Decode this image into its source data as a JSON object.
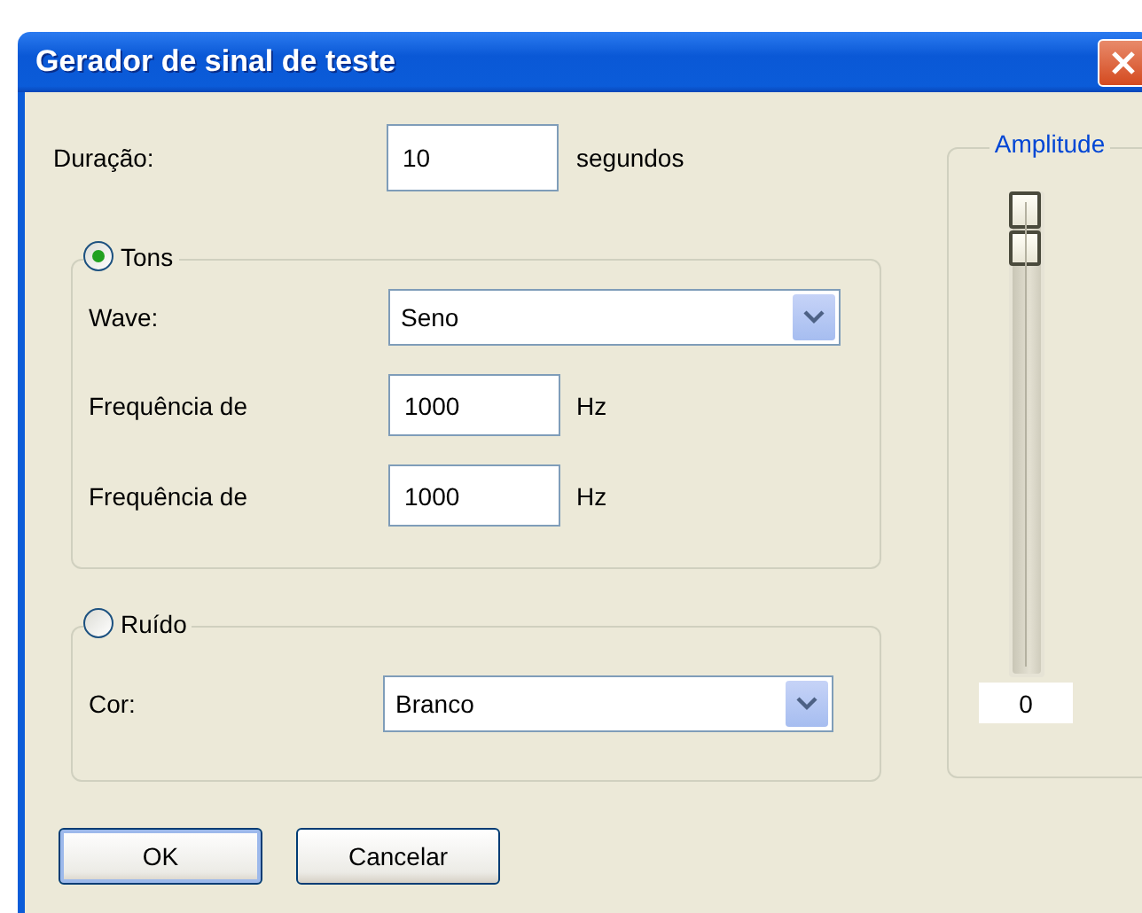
{
  "window": {
    "title": "Gerador de sinal de teste"
  },
  "duration": {
    "label": "Duração:",
    "value": "10",
    "unit": "segundos"
  },
  "groups": [
    {
      "kind": "tones",
      "label": "Tons",
      "selected": true,
      "rows": [
        {
          "kind": "select",
          "label": "Wave:",
          "value": "Seno"
        },
        {
          "kind": "input",
          "label": "Frequência de",
          "value": "1000",
          "unit": "Hz"
        },
        {
          "kind": "input",
          "label": "Frequência de",
          "value": "1000",
          "unit": "Hz"
        }
      ]
    },
    {
      "kind": "noise",
      "label": "Ruído",
      "selected": false,
      "rows": [
        {
          "kind": "select",
          "label": "Cor:",
          "value": "Branco"
        }
      ]
    }
  ],
  "amplitude": {
    "label": "Amplitude",
    "level": 1,
    "reading": "0"
  },
  "buttons": [
    {
      "label": "OK",
      "default": true
    },
    {
      "label": "Cancelar",
      "default": false
    }
  ]
}
